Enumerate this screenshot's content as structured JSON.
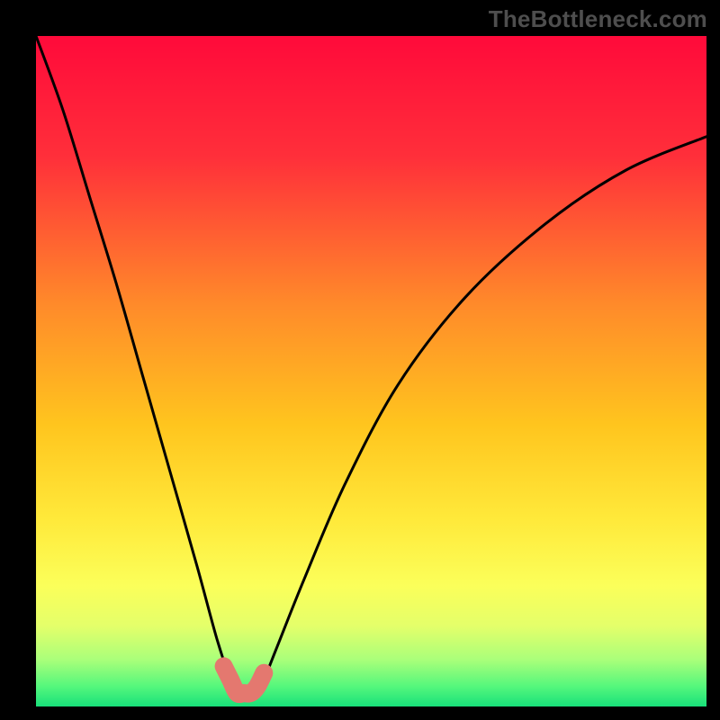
{
  "watermark": "TheBottleneck.com",
  "chart_data": {
    "type": "line",
    "title": "",
    "xlabel": "",
    "ylabel": "",
    "xlim": [
      0,
      100
    ],
    "ylim": [
      0,
      100
    ],
    "grid": false,
    "legend": false,
    "series": [
      {
        "name": "bottleneck-curve",
        "type": "line",
        "x": [
          0,
          4,
          8,
          12,
          16,
          20,
          24,
          27,
          29,
          30,
          31,
          33,
          34,
          36,
          40,
          46,
          54,
          64,
          76,
          88,
          100
        ],
        "values": [
          100,
          89,
          76,
          63,
          49,
          35,
          21,
          10,
          4,
          2,
          2,
          2,
          4,
          9,
          19,
          33,
          48,
          61,
          72,
          80,
          85
        ]
      }
    ],
    "highlight_segment": {
      "name": "optimal-range",
      "x": [
        28,
        29,
        30,
        31,
        32,
        33,
        34
      ],
      "values": [
        6,
        4,
        2,
        2,
        2,
        3,
        5
      ]
    },
    "background_gradient": {
      "type": "vertical",
      "stops": [
        {
          "pos": 0.0,
          "color": "#ff0a3a"
        },
        {
          "pos": 0.18,
          "color": "#ff2f3a"
        },
        {
          "pos": 0.4,
          "color": "#ff8a2a"
        },
        {
          "pos": 0.58,
          "color": "#ffc51e"
        },
        {
          "pos": 0.72,
          "color": "#ffe93a"
        },
        {
          "pos": 0.82,
          "color": "#fbff5a"
        },
        {
          "pos": 0.88,
          "color": "#e4ff6a"
        },
        {
          "pos": 0.93,
          "color": "#aaff7a"
        },
        {
          "pos": 0.97,
          "color": "#55f77c"
        },
        {
          "pos": 1.0,
          "color": "#18e07a"
        }
      ]
    },
    "colors": {
      "curve": "#000000",
      "highlight": "#e4786f",
      "frame": "#000000"
    }
  }
}
